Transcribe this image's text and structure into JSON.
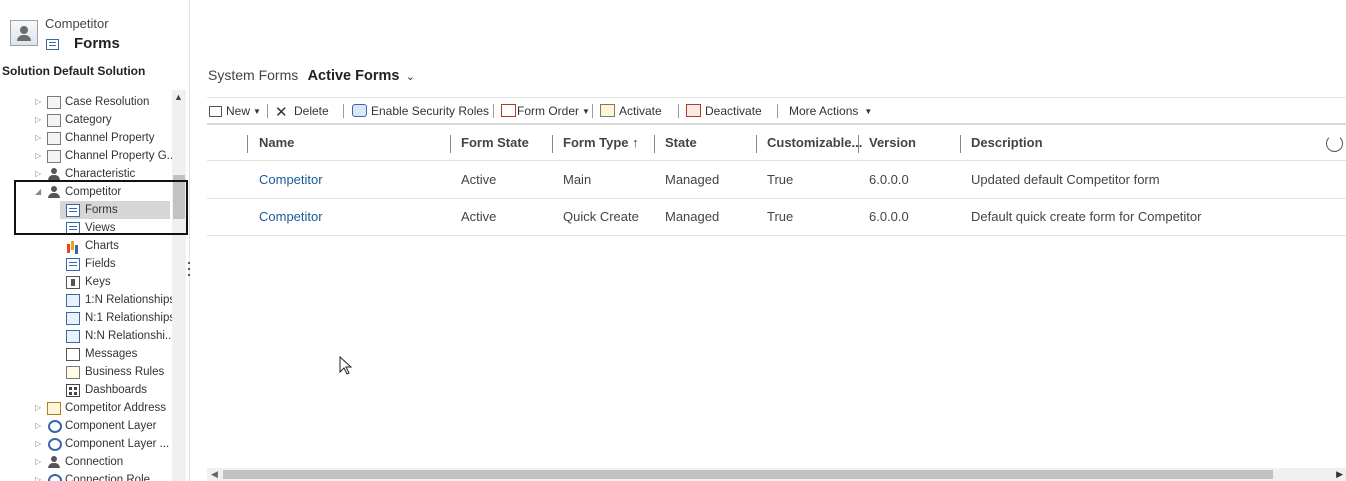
{
  "sidebar": {
    "entity_name": "Competitor",
    "entity_page": "Forms",
    "solution_label": "Solution Default Solution",
    "tree": [
      {
        "label": "Case Resolution",
        "icon": "case-resolution-icon",
        "arrow": "▷",
        "level": 0
      },
      {
        "label": "Category",
        "icon": "category-icon",
        "arrow": "▷",
        "level": 0
      },
      {
        "label": "Channel Property",
        "icon": "channel-property-icon",
        "arrow": "▷",
        "level": 0
      },
      {
        "label": "Channel Property G...",
        "icon": "channel-property-group-icon",
        "arrow": "▷",
        "level": 0
      },
      {
        "label": "Characteristic",
        "icon": "characteristic-icon",
        "arrow": "▷",
        "level": 0
      },
      {
        "label": "Competitor",
        "icon": "competitor-icon",
        "arrow": "◢",
        "level": 0
      },
      {
        "label": "Forms",
        "icon": "forms-icon",
        "arrow": "",
        "level": 1,
        "selected": true
      },
      {
        "label": "Views",
        "icon": "views-icon",
        "arrow": "",
        "level": 1
      },
      {
        "label": "Charts",
        "icon": "charts-icon",
        "arrow": "",
        "level": 1
      },
      {
        "label": "Fields",
        "icon": "fields-icon",
        "arrow": "",
        "level": 1
      },
      {
        "label": "Keys",
        "icon": "keys-icon",
        "arrow": "",
        "level": 1
      },
      {
        "label": "1:N Relationships",
        "icon": "one-to-many-relationship-icon",
        "arrow": "",
        "level": 1
      },
      {
        "label": "N:1 Relationships",
        "icon": "many-to-one-relationship-icon",
        "arrow": "",
        "level": 1
      },
      {
        "label": "N:N Relationshi...",
        "icon": "many-to-many-relationship-icon",
        "arrow": "",
        "level": 1
      },
      {
        "label": "Messages",
        "icon": "messages-icon",
        "arrow": "",
        "level": 1
      },
      {
        "label": "Business Rules",
        "icon": "business-rules-icon",
        "arrow": "",
        "level": 1
      },
      {
        "label": "Dashboards",
        "icon": "dashboards-icon",
        "arrow": "",
        "level": 1
      },
      {
        "label": "Competitor Address",
        "icon": "competitor-address-icon",
        "arrow": "▷",
        "level": 0
      },
      {
        "label": "Component Layer",
        "icon": "component-layer-icon",
        "arrow": "▷",
        "level": 0
      },
      {
        "label": "Component Layer ...",
        "icon": "component-layer-data-icon",
        "arrow": "▷",
        "level": 0
      },
      {
        "label": "Connection",
        "icon": "connection-icon",
        "arrow": "▷",
        "level": 0
      },
      {
        "label": "Connection Role",
        "icon": "connection-role-icon",
        "arrow": "▷",
        "level": 0
      }
    ]
  },
  "main": {
    "view_prefix": "System Forms",
    "view_name": "Active Forms",
    "view_chevron": "⌄",
    "commands": {
      "new": "New",
      "delete": "Delete",
      "enable_security_roles": "Enable Security Roles",
      "form_order": "Form Order",
      "activate": "Activate",
      "deactivate": "Deactivate",
      "more_actions": "More Actions"
    },
    "columns": {
      "name": "Name",
      "form_state": "Form State",
      "form_type": "Form Type ↑",
      "state": "State",
      "customizable": "Customizable...",
      "version": "Version",
      "description": "Description"
    },
    "rows": [
      {
        "name": "Competitor",
        "form_state": "Active",
        "form_type": "Main",
        "state": "Managed",
        "customizable": "True",
        "version": "6.0.0.0",
        "description": "Updated default Competitor form"
      },
      {
        "name": "Competitor",
        "form_state": "Active",
        "form_type": "Quick Create",
        "state": "Managed",
        "customizable": "True",
        "version": "6.0.0.0",
        "description": "Default quick create form for Competitor"
      }
    ]
  },
  "colors": {
    "link": "#1b5a9e",
    "selected_row": "#d6d6d6",
    "scrollbar_thumb": "#c2c2c2"
  }
}
